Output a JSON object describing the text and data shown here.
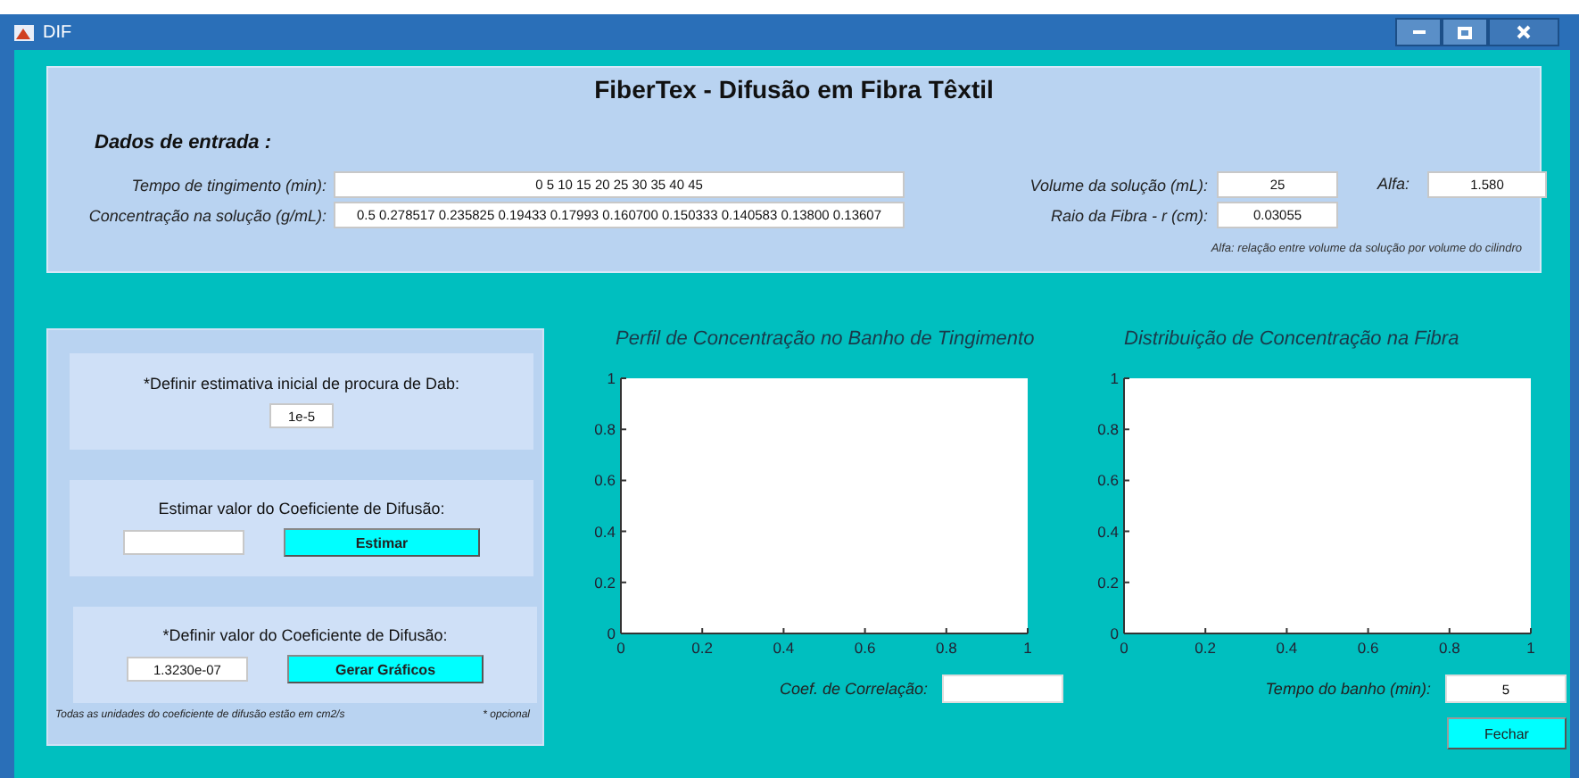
{
  "window": {
    "title": "DIF"
  },
  "header": {
    "title": "FiberTex - Difusão em Fibra Têxtil",
    "section_label": "Dados de entrada :",
    "series_inputs": [
      {
        "label": "Tempo de tingimento (min):",
        "value": "0 5 10 15 20 25 30 35 40 45"
      },
      {
        "label": "Concentração na solução (g/mL):",
        "value": "0.5 0.278517 0.235825 0.19433 0.17993 0.160700 0.150333 0.140583 0.13800 0.13607"
      }
    ],
    "parameter_inputs": [
      {
        "label": "Volume da solução (mL):",
        "value": "25"
      },
      {
        "label": "Raio da Fibra - r (cm):",
        "value": "0.03055"
      }
    ],
    "alfa": {
      "label": "Alfa:",
      "value": "1.580"
    },
    "note": "Alfa: relação entre volume da solução por volume do cilindro"
  },
  "steps": [
    {
      "label": "*Definir estimativa inicial de procura de Dab:",
      "value": "1e-5"
    },
    {
      "label": "Estimar valor do Coeficiente de Difusão:",
      "button": "Estimar"
    },
    {
      "label": "*Definir valor do Coeficiente de Difusão:",
      "value": "1.3230e-07",
      "button": "Gerar Gráficos"
    }
  ],
  "units_note": "Todas as unidades do coeficiente de difusão estão em cm2/s",
  "optional_note": "* opcional",
  "charts": [
    {
      "chart_data": {
        "type": "line",
        "title": "Perfil de Concentração no Banho de Tingimento",
        "xlim": [
          0,
          1
        ],
        "ylim": [
          0,
          1
        ],
        "xticks": [
          0,
          0.2,
          0.4,
          0.6,
          0.8,
          1
        ],
        "yticks": [
          0,
          0.2,
          0.4,
          0.6,
          0.8,
          1
        ]
      },
      "field_label": "Coef. de Correlação:"
    },
    {
      "chart_data": {
        "type": "line",
        "title": "Distribuição de Concentração na Fibra",
        "xlim": [
          0,
          1
        ],
        "ylim": [
          0,
          1
        ],
        "xticks": [
          0,
          0.2,
          0.4,
          0.6,
          0.8,
          1
        ],
        "yticks": [
          0,
          0.2,
          0.4,
          0.6,
          0.8,
          1
        ]
      },
      "field_label": "Tempo do banho (min):",
      "field_value": "5"
    }
  ],
  "close_button": "Fechar"
}
